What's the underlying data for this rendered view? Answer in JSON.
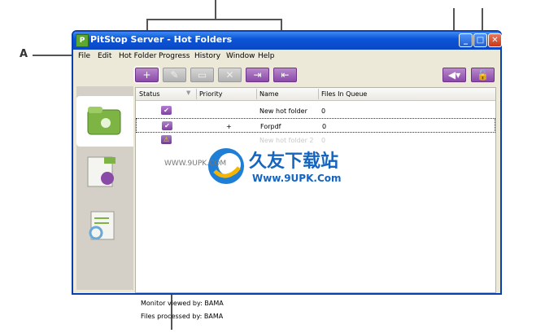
{
  "callout": {
    "label": "A"
  },
  "window": {
    "title": "PitStop Server - Hot Folders",
    "app_icon": "pitstop-icon",
    "buttons": [
      "minimize",
      "maximize",
      "close"
    ]
  },
  "menu": [
    "File",
    "Edit",
    "Hot Folder",
    "Progress",
    "History",
    "Window",
    "Help"
  ],
  "toolbar": {
    "left": [
      {
        "name": "new-hot-folder-icon",
        "enabled": true
      },
      {
        "name": "edit-pencil-icon",
        "enabled": false
      },
      {
        "name": "folder-icon",
        "enabled": false
      },
      {
        "name": "delete-x-icon",
        "enabled": false
      },
      {
        "name": "import-icon",
        "enabled": true
      },
      {
        "name": "export-icon",
        "enabled": true
      }
    ],
    "right": [
      {
        "name": "megaphone-icon",
        "enabled": true
      },
      {
        "name": "unlock-icon",
        "enabled": true
      }
    ]
  },
  "sidebar": [
    "hot-folders-icon",
    "pdf-preflight-icon",
    "report-icon"
  ],
  "table": {
    "columns": [
      "Status",
      "Priority",
      "Name",
      "Files In Queue"
    ],
    "rows": [
      {
        "status": "check",
        "priority": "",
        "name": "New hot folder",
        "files": "0",
        "selected": false,
        "dim": false
      },
      {
        "status": "check",
        "priority": "+",
        "name": "Forpdf",
        "files": "0",
        "selected": true,
        "dim": false
      },
      {
        "status": "warning",
        "priority": "",
        "name": "New hot folder 2",
        "files": "0",
        "selected": false,
        "dim": true
      }
    ]
  },
  "footer": {
    "monitor": "Monitor viewed by: BAMA",
    "files": "Files processed by: BAMA"
  },
  "watermark": {
    "brand": "久友下载站",
    "url": "Www.9UPK.Com",
    "url_left": "WWW.9UPK.COM"
  },
  "colors": {
    "accent": "#8a4aa8",
    "title_bar": "#0a48c4"
  }
}
